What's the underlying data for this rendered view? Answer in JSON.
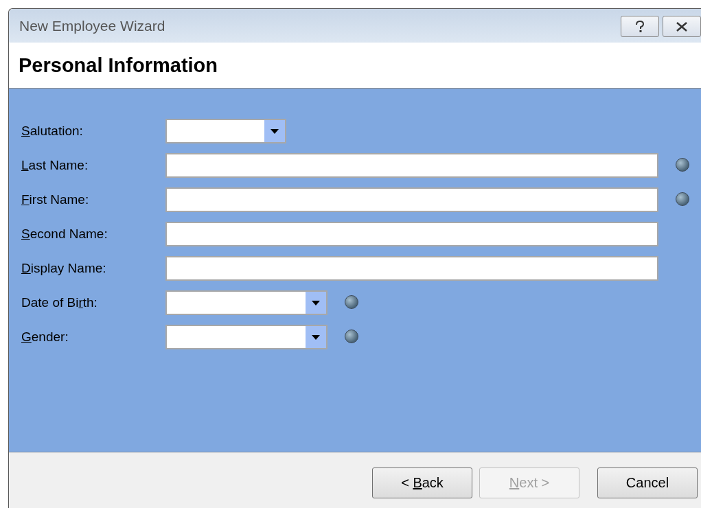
{
  "window": {
    "title": "New Employee Wizard"
  },
  "page_title": "Personal Information",
  "fields": [
    {
      "label": {
        "key": "S",
        "after": "alutation:"
      },
      "kind": "short_combo",
      "required": false
    },
    {
      "label": {
        "key": "L",
        "after": "ast Name:"
      },
      "kind": "text",
      "required": true
    },
    {
      "label": {
        "key": "F",
        "after": "irst Name:"
      },
      "kind": "text",
      "required": true
    },
    {
      "label": {
        "key": "S",
        "after": "econd Name:"
      },
      "kind": "text",
      "required": false
    },
    {
      "label": {
        "key": "D",
        "after": "isplay Name:"
      },
      "kind": "text",
      "required": false
    },
    {
      "label": {
        "before": "Date of Bi",
        "key": "r",
        "after": "th:"
      },
      "kind": "combo",
      "required": true
    },
    {
      "label": {
        "key": "G",
        "after": "ender:"
      },
      "kind": "combo",
      "required": true
    }
  ],
  "buttons": [
    {
      "label": {
        "before": "< ",
        "key": "B",
        "after": "ack"
      },
      "disabled": false
    },
    {
      "label": {
        "key": "N",
        "after": "ext >"
      },
      "disabled": true
    },
    {
      "label": {
        "after": "Cancel"
      },
      "disabled": false
    }
  ]
}
